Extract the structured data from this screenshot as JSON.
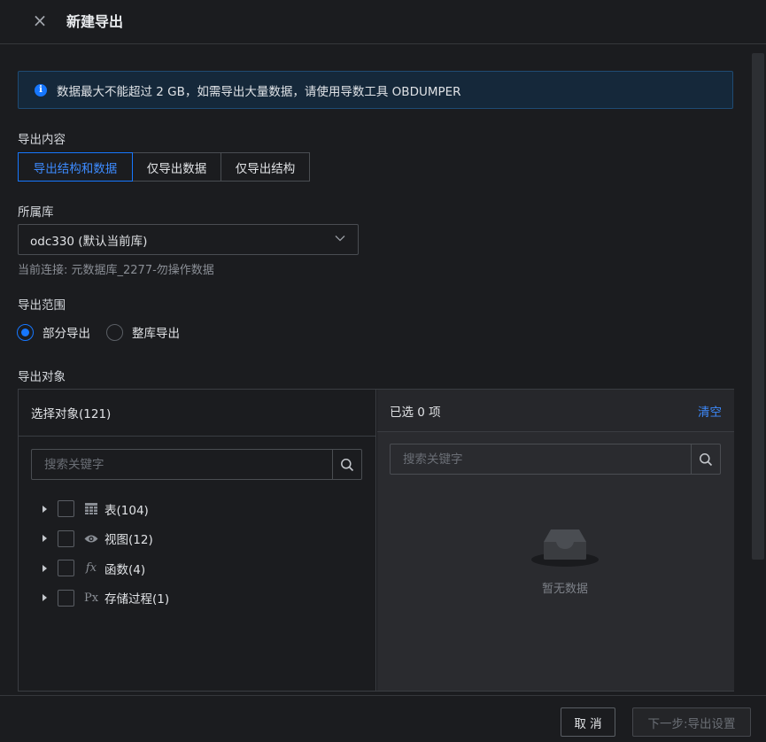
{
  "header": {
    "title": "新建导出",
    "close_icon": "×"
  },
  "alert": {
    "text": "数据最大不能超过 2 GB，如需导出大量数据，请使用导数工具 OBDUMPER"
  },
  "export_content": {
    "label": "导出内容",
    "options": [
      "导出结构和数据",
      "仅导出数据",
      "仅导出结构"
    ],
    "selected": "导出结构和数据"
  },
  "database": {
    "label": "所属库",
    "value": "odc330 (默认当前库)",
    "hint": "当前连接: 元数据库_2277-勿操作数据"
  },
  "export_scope": {
    "label": "导出范围",
    "options": [
      "部分导出",
      "整库导出"
    ],
    "selected": "部分导出"
  },
  "export_objects": {
    "label": "导出对象",
    "left": {
      "title": "选择对象(121)",
      "search_placeholder": "搜索关键字",
      "items": [
        {
          "label": "表(104)",
          "icon": "table-icon"
        },
        {
          "label": "视图(12)",
          "icon": "eye-icon"
        },
        {
          "label": "函数(4)",
          "icon": "function-icon"
        },
        {
          "label": "存储过程(1)",
          "icon": "procedure-icon"
        }
      ]
    },
    "right": {
      "title": "已选 0 项",
      "clear": "清空",
      "search_placeholder": "搜索关键字",
      "empty_text": "暂无数据"
    }
  },
  "footer": {
    "cancel": "取 消",
    "next": "下一步:导出设置"
  },
  "colors": {
    "accent": "#1677ff",
    "background": "#1b1c1f"
  }
}
